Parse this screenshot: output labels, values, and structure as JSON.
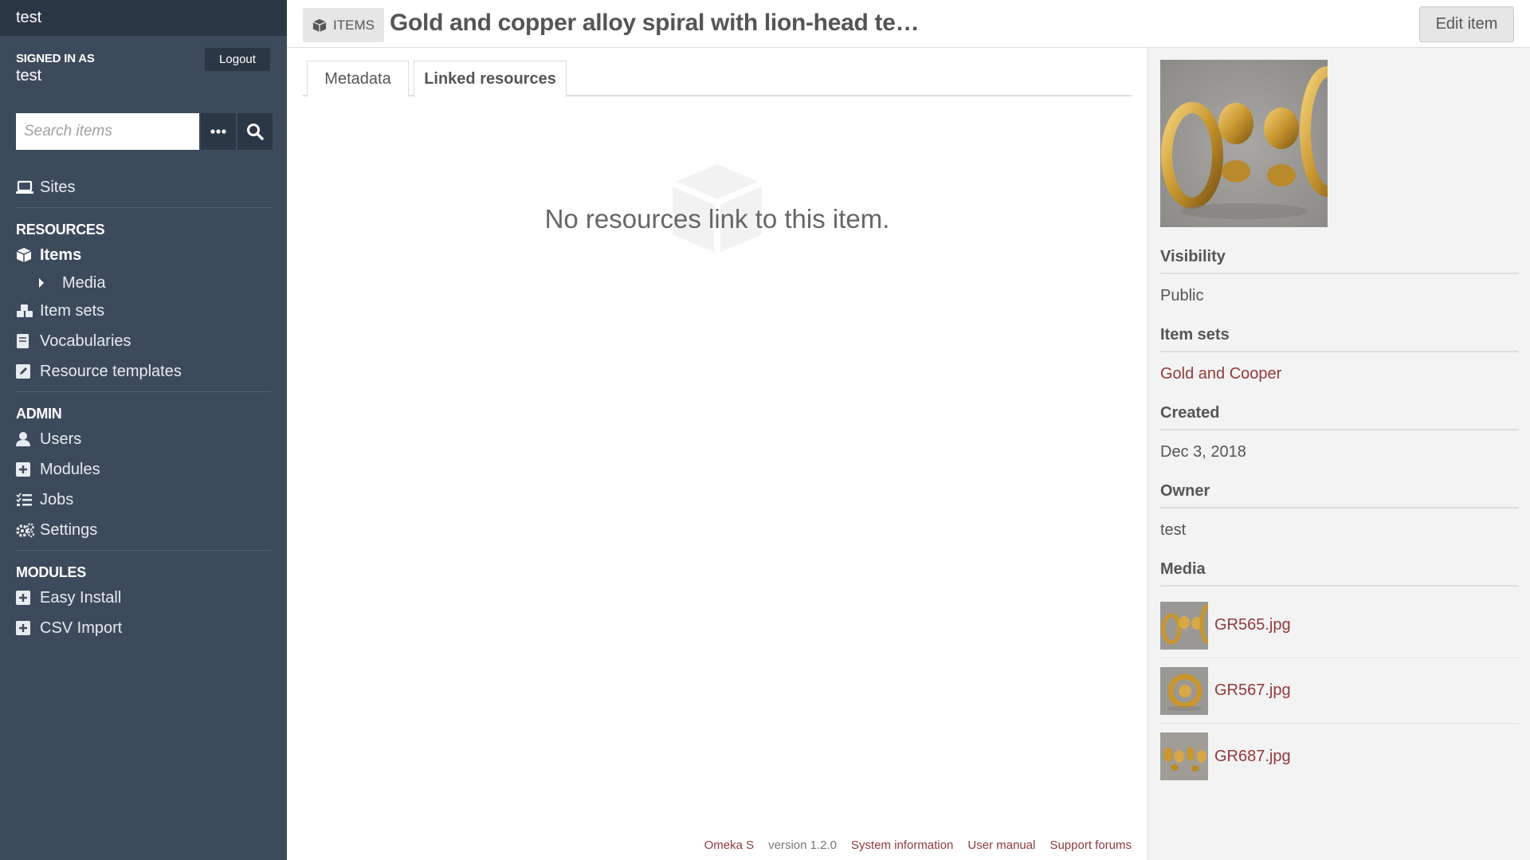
{
  "site": {
    "name": "test"
  },
  "user": {
    "signed_in_label": "SIGNED IN AS",
    "name": "test",
    "logout_label": "Logout"
  },
  "search": {
    "placeholder": "Search items"
  },
  "nav": {
    "sites_label": "Sites",
    "resources_heading": "RESOURCES",
    "items_label": "Items",
    "media_label": "Media",
    "item_sets_label": "Item sets",
    "vocabularies_label": "Vocabularies",
    "resource_templates_label": "Resource templates",
    "admin_heading": "ADMIN",
    "users_label": "Users",
    "modules_label": "Modules",
    "jobs_label": "Jobs",
    "settings_label": "Settings",
    "modules_heading": "MODULES",
    "easy_install_label": "Easy Install",
    "csv_import_label": "CSV Import"
  },
  "header": {
    "crumb_label": "ITEMS",
    "title": "Gold and copper alloy spiral with lion-head te…",
    "edit_label": "Edit item"
  },
  "tabs": [
    {
      "label": "Metadata",
      "active": false
    },
    {
      "label": "Linked resources",
      "active": true
    }
  ],
  "empty_message": "No resources link to this item.",
  "aside": {
    "visibility_heading": "Visibility",
    "visibility_value": "Public",
    "item_sets_heading": "Item sets",
    "item_sets_value": "Gold and Cooper",
    "created_heading": "Created",
    "created_value": "Dec 3, 2018",
    "owner_heading": "Owner",
    "owner_value": "test",
    "media_heading": "Media",
    "media": [
      {
        "name": "GR565.jpg"
      },
      {
        "name": "GR567.jpg"
      },
      {
        "name": "GR687.jpg"
      }
    ]
  },
  "footer": {
    "product": "Omeka S",
    "version": "version 1.2.0",
    "system_info": "System information",
    "user_manual": "User manual",
    "support_forums": "Support forums"
  },
  "colors": {
    "sidebar_bg": "#3d4a5c",
    "sidebar_dark": "#2c3745",
    "link": "#913a3a",
    "aside_bg": "#f3f3f3"
  }
}
